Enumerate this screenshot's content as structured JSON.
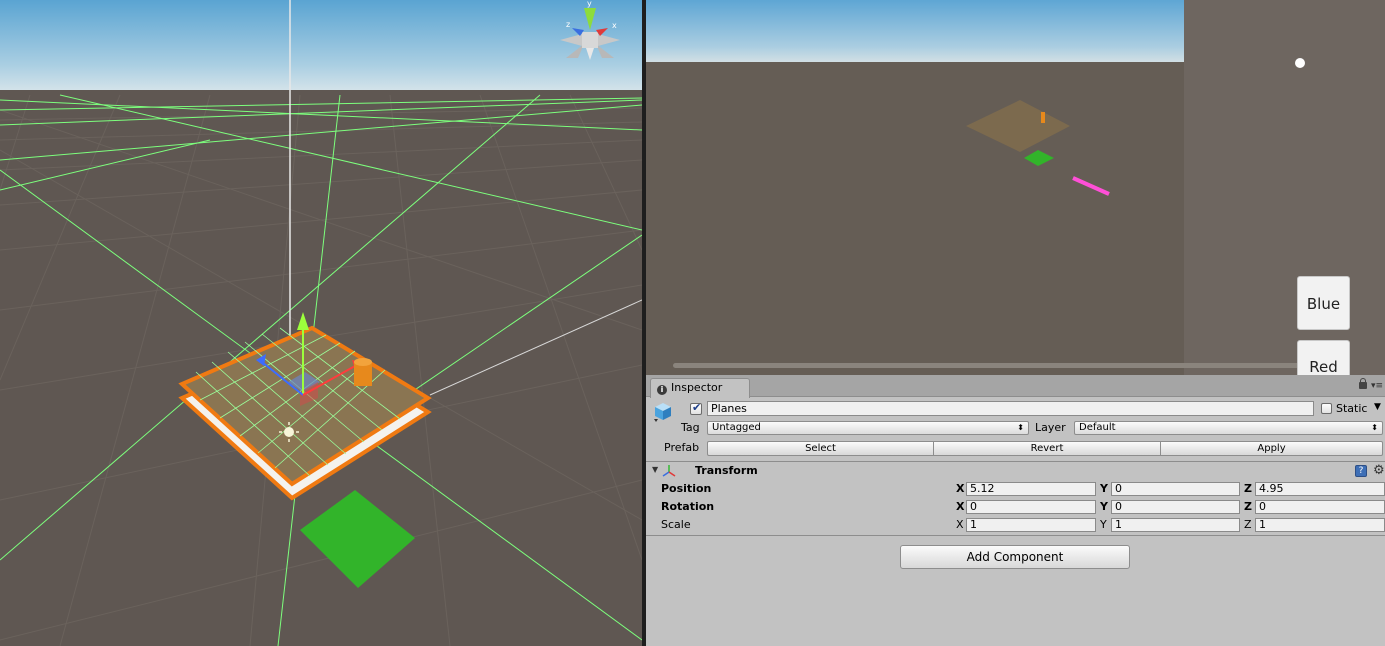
{
  "game_view": {
    "buttons": {
      "blue": "Blue",
      "red": "Red"
    }
  },
  "inspector": {
    "tab_label": "Inspector",
    "object": {
      "active": true,
      "name": "Planes",
      "static_label": "Static",
      "static": false,
      "tag_label": "Tag",
      "tag_value": "Untagged",
      "layer_label": "Layer",
      "layer_value": "Default"
    },
    "prefab": {
      "label": "Prefab",
      "select": "Select",
      "revert": "Revert",
      "apply": "Apply"
    },
    "transform": {
      "title": "Transform",
      "rows": [
        {
          "label": "Position",
          "x": "5.12",
          "y": "0",
          "z": "4.95"
        },
        {
          "label": "Rotation",
          "x": "0",
          "y": "0",
          "z": "0"
        },
        {
          "label": "Scale",
          "x": "1",
          "y": "1",
          "z": "1"
        }
      ],
      "axis_labels": {
        "x": "X",
        "y": "Y",
        "z": "Z"
      }
    },
    "add_component": "Add Component"
  },
  "colors": {
    "scene_ground": "#5f5752",
    "scene_grid": "#7dff7d",
    "selection_outline": "#f07a12",
    "green_plane": "#32b42a",
    "game_ground": "#655d55",
    "inspector_bg": "#c2c2c2"
  }
}
